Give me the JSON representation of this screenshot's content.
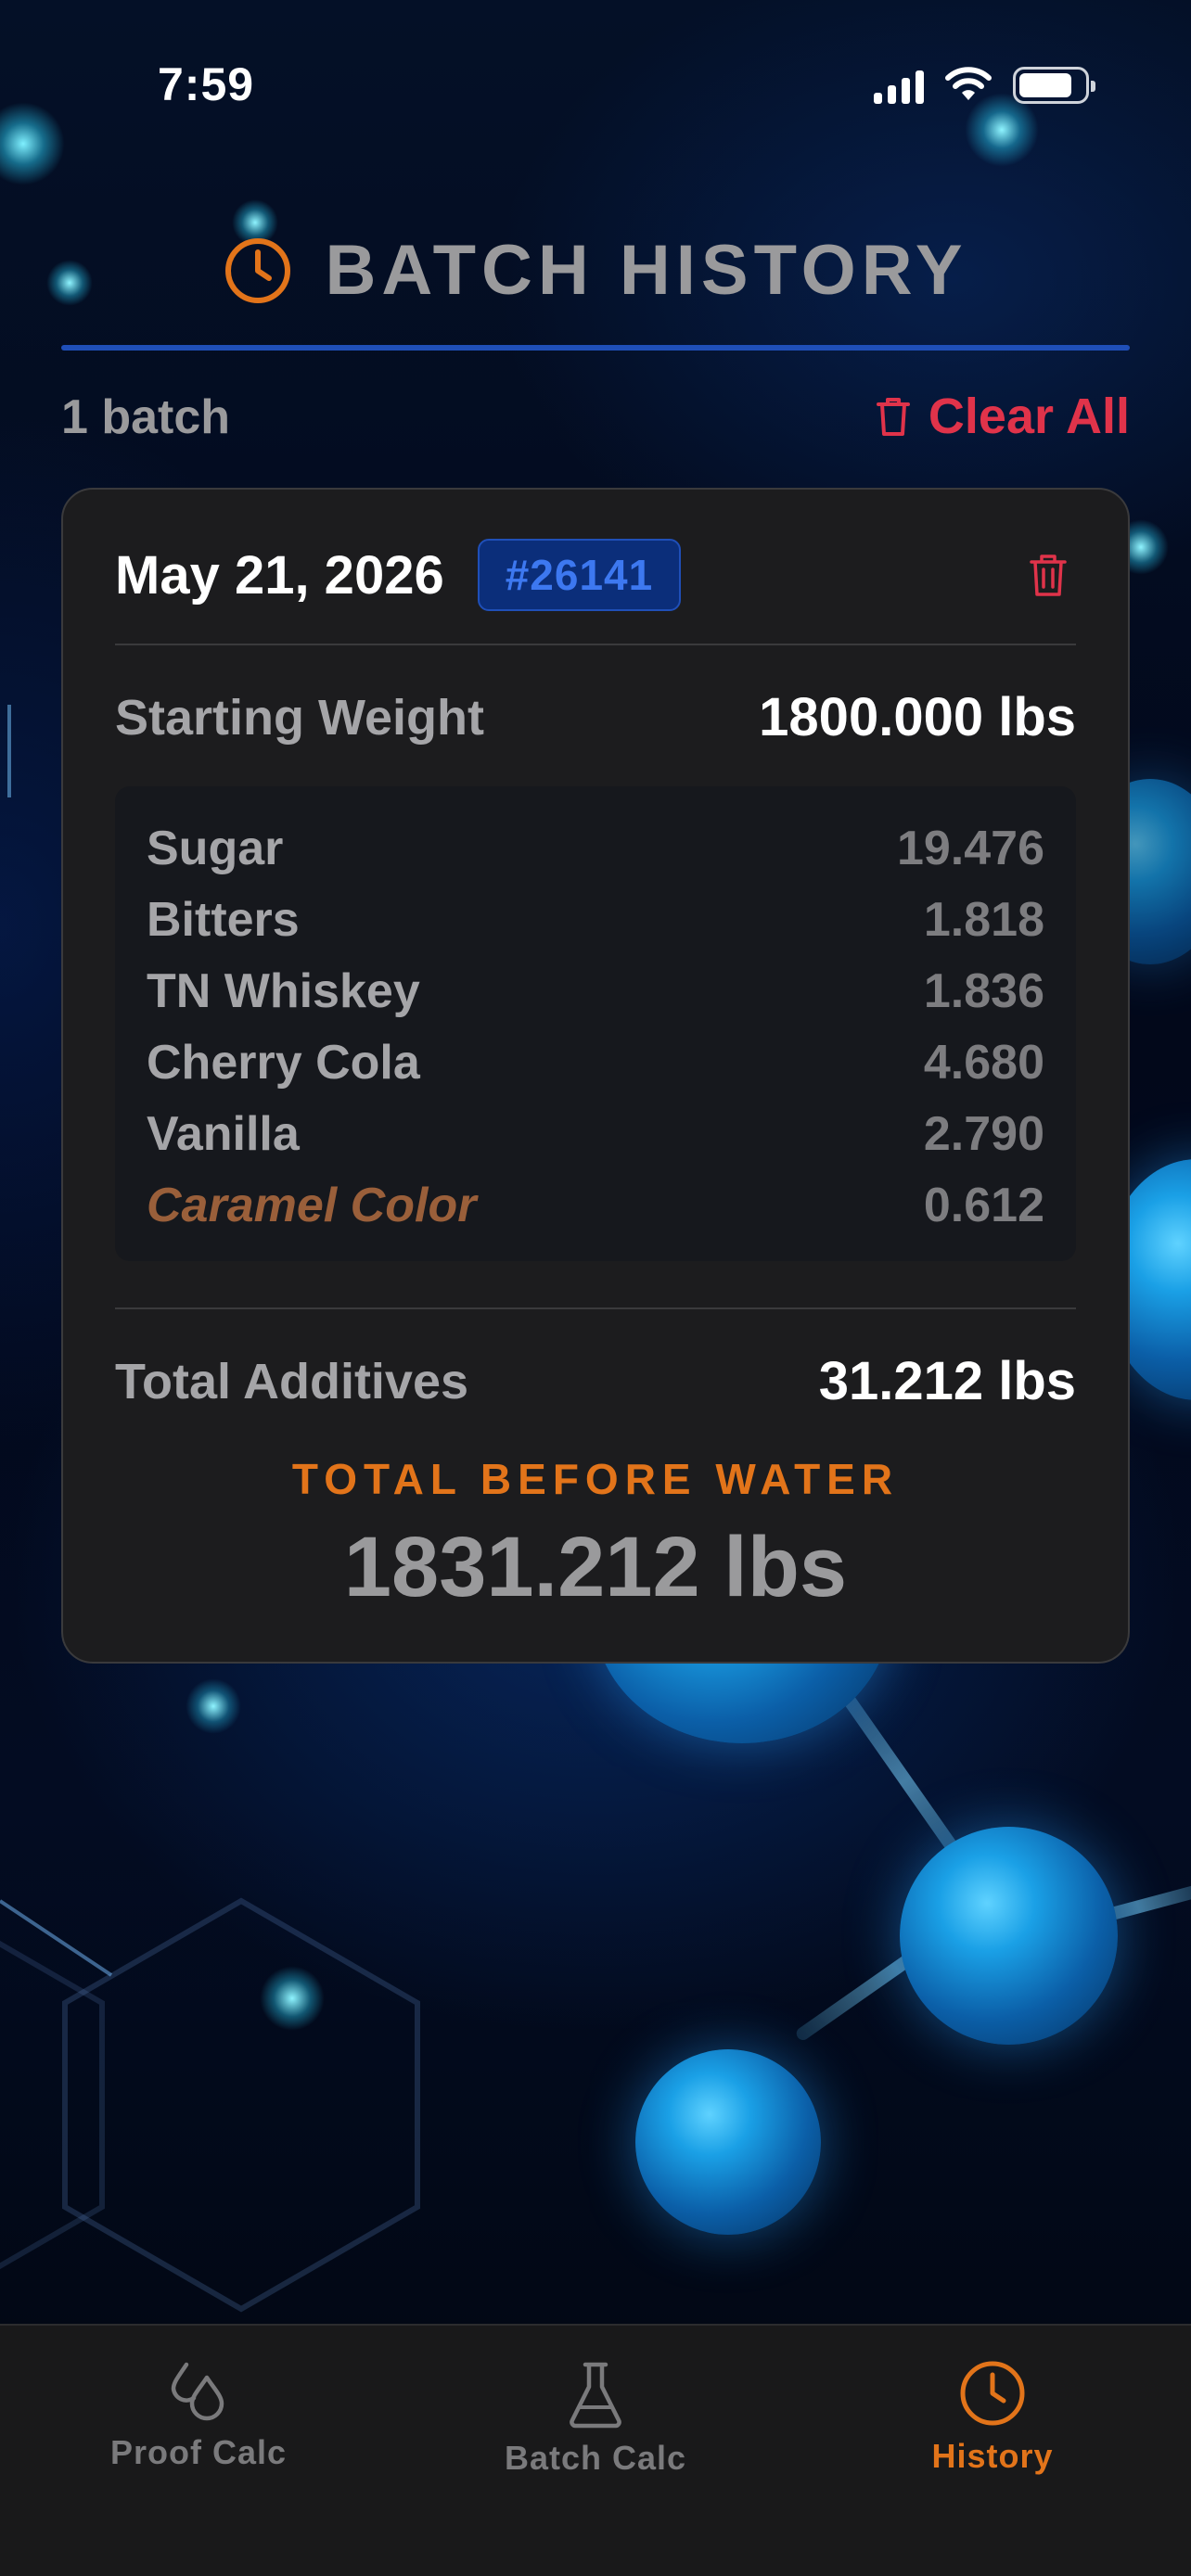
{
  "status_bar": {
    "time": "7:59"
  },
  "header": {
    "title": "BATCH HISTORY",
    "icon": "clock-icon",
    "accent": "#e2741a",
    "line_color": "#1f4fb8"
  },
  "summary": {
    "batch_count": "1 batch",
    "clear_all_label": "Clear All",
    "clear_color": "#e0334a"
  },
  "batch": {
    "date": "May 21, 2026",
    "id": "#26141",
    "starting_weight_label": "Starting Weight",
    "starting_weight_value": "1800.000 lbs",
    "ingredients": [
      {
        "name": "Sugar",
        "amount": "19.476"
      },
      {
        "name": "Bitters",
        "amount": "1.818"
      },
      {
        "name": "TN Whiskey",
        "amount": "1.836"
      },
      {
        "name": "Cherry Cola",
        "amount": "4.680"
      },
      {
        "name": "Vanilla",
        "amount": "2.790"
      },
      {
        "name": "Caramel Color",
        "amount": "0.612"
      }
    ],
    "total_additives_label": "Total Additives",
    "total_additives_value": "31.212 lbs",
    "total_before_water_label": "TOTAL BEFORE WATER",
    "total_before_water_value": "1831.212 lbs"
  },
  "tabs": [
    {
      "label": "Proof Calc",
      "icon": "drops-icon",
      "active": false
    },
    {
      "label": "Batch Calc",
      "icon": "flask-icon",
      "active": false
    },
    {
      "label": "History",
      "icon": "clock-icon",
      "active": true
    }
  ]
}
